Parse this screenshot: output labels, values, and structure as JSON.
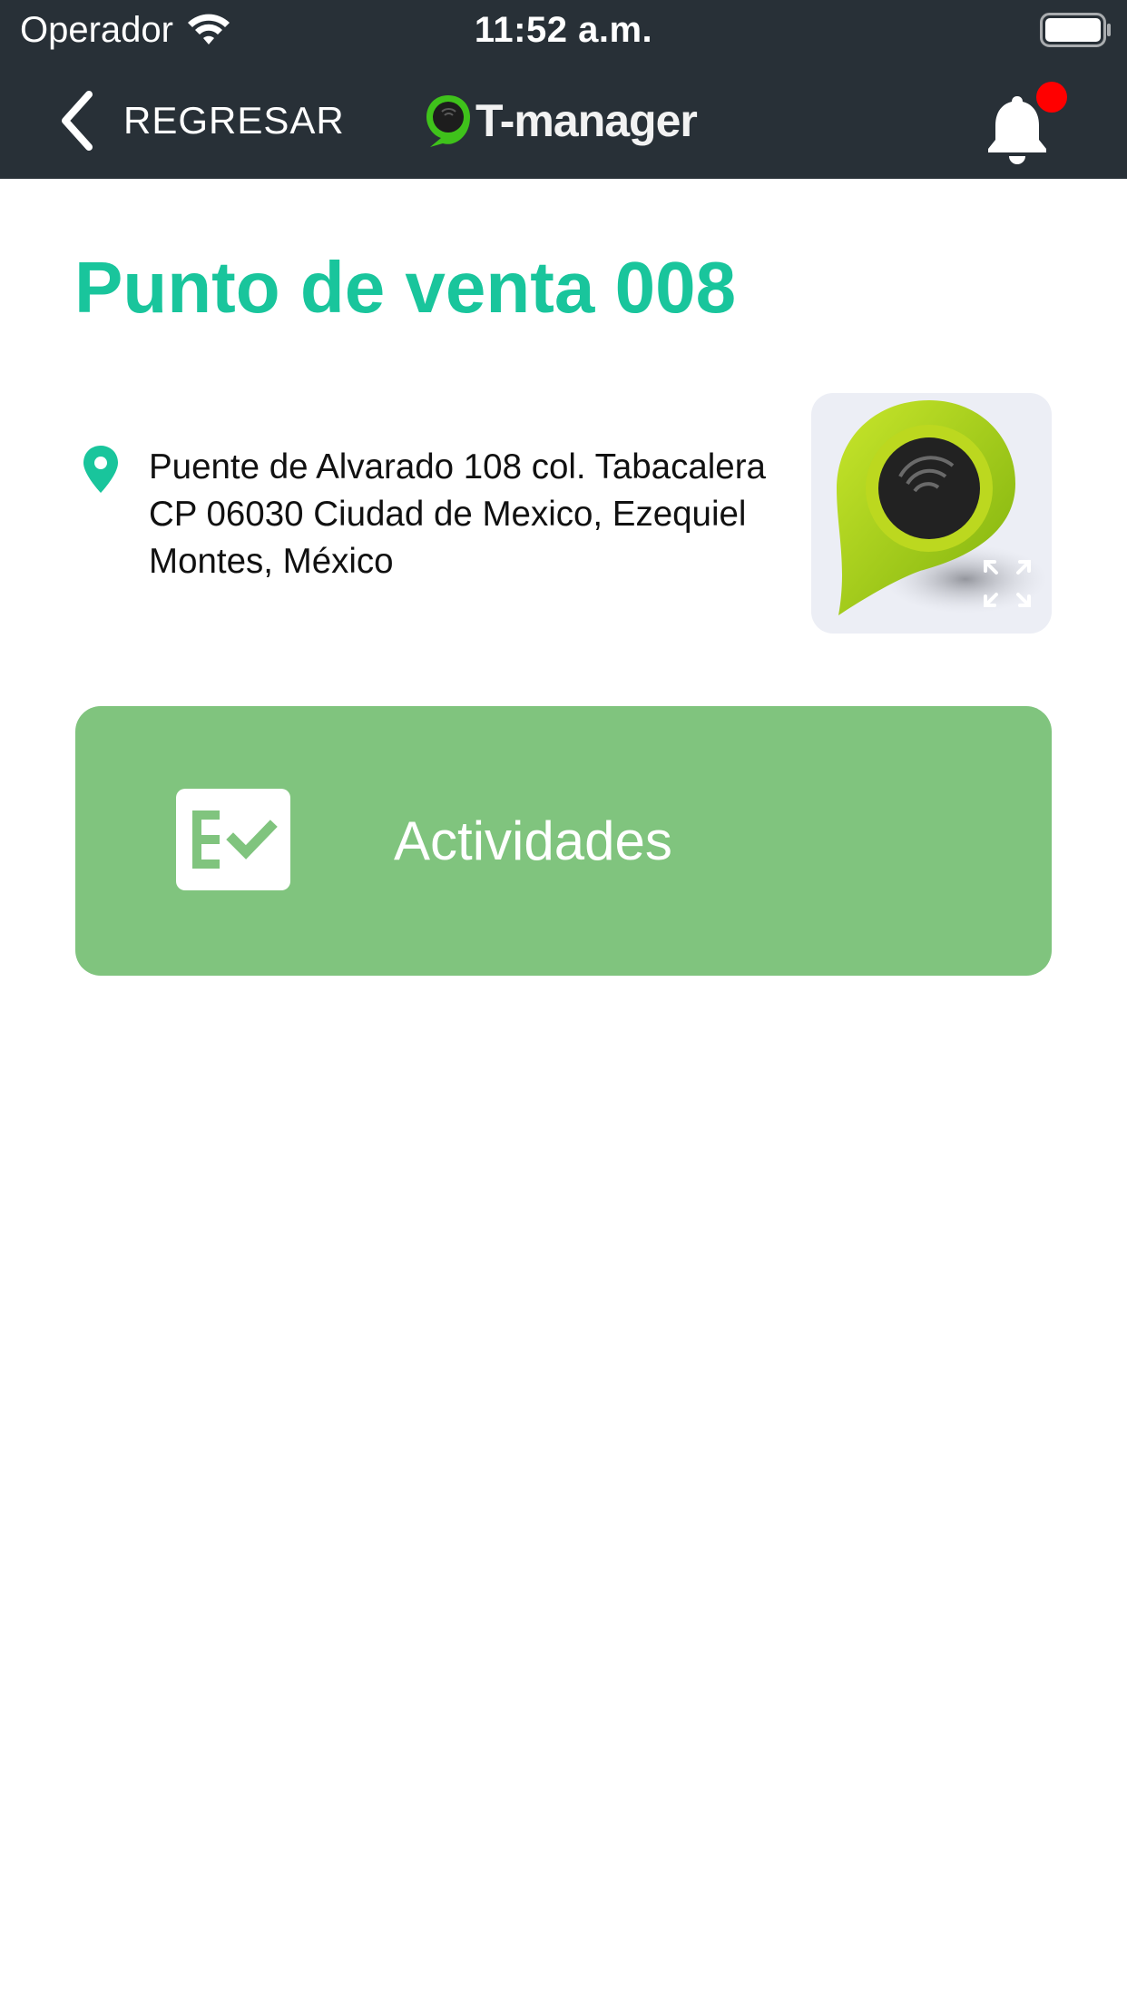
{
  "status_bar": {
    "carrier": "Operador",
    "time": "11:52 a.m.",
    "icons": [
      "wifi-icon",
      "battery-icon"
    ]
  },
  "nav": {
    "back_label": "REGRESAR",
    "brand_name": "T-manager",
    "icons": [
      "chevron-left-icon",
      "brand-logo-icon",
      "bell-icon"
    ],
    "has_notification": true
  },
  "store": {
    "title": "Punto de venta 008",
    "address": "Puente de Alvarado 108 col. Tabacalera CP 06030 Ciudad de Mexico, Ezequiel Montes, México",
    "icons": [
      "pin-icon",
      "expand-icon"
    ]
  },
  "actions": [
    {
      "label": "Actividades",
      "icon": "checklist-icon"
    }
  ],
  "colors": {
    "header_bg": "#283037",
    "title_green": "#19c59c",
    "card_green": "#80c47e",
    "notification_red": "#ff0000",
    "image_bg": "#eceef5"
  }
}
